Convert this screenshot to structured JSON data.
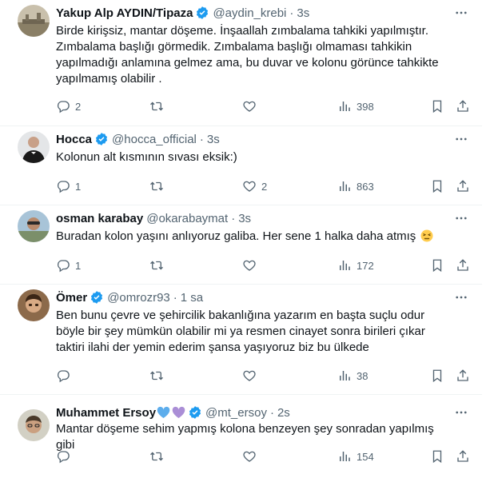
{
  "tweets": [
    {
      "name": "Yakup Alp AYDIN/Tipaza",
      "verified": true,
      "handle": "@aydin_krebi",
      "time": "3s",
      "text": "Birde kirişsiz, mantar döşeme. İnşaallah zımbalama tahkiki yapılmıştır. Zımbalama başlığı görmedik. Zımbalama başlığı olmaması tahkikin yapılmadığı anlamına gelmez ama, bu duvar ve kolonu görünce tahkikte yapılmamış olabilir .",
      "replies": "2",
      "retweets": "",
      "likes": "",
      "views": "398"
    },
    {
      "name": "Hocca",
      "verified": true,
      "handle": "@hocca_official",
      "time": "3s",
      "text": "Kolonun alt kısmının sıvası eksik:)",
      "replies": "1",
      "retweets": "",
      "likes": "2",
      "views": "863"
    },
    {
      "name": "osman karabay",
      "verified": false,
      "handle": "@okarabaymat",
      "time": "3s",
      "text": "Buradan kolon yaşını anlıyoruz galiba. Her sene 1 halka daha atmış",
      "emoji": "persevering-face",
      "replies": "1",
      "retweets": "",
      "likes": "",
      "views": "172"
    },
    {
      "name": "Ömer",
      "verified": true,
      "handle": "@omrozr93",
      "time": "1 sa",
      "text": "Ben bunu çevre ve şehircilik bakanlığına yazarım en başta suçlu odur böyle bir şey mümkün olabilir mi ya resmen cinayet sonra birileri çıkar taktiri ilahi der yemin ederim şansa yaşıyoruz biz bu ülkede",
      "replies": "",
      "retweets": "",
      "likes": "",
      "views": "38"
    },
    {
      "name": "Muhammet Ersoy",
      "name_hearts": [
        "blue-heart",
        "purple-heart"
      ],
      "verified": true,
      "handle": "@mt_ersoy",
      "time": "2s",
      "text": "Mantar döşeme sehim yapmış kolona benzeyen şey  sonradan yapılmış gibi",
      "replies": "",
      "retweets": "",
      "likes": "",
      "views": "154"
    }
  ],
  "colors": {
    "verified": "#1d9bf0",
    "secondary": "#536471",
    "text": "#0f1419",
    "divider": "#eff3f4"
  }
}
